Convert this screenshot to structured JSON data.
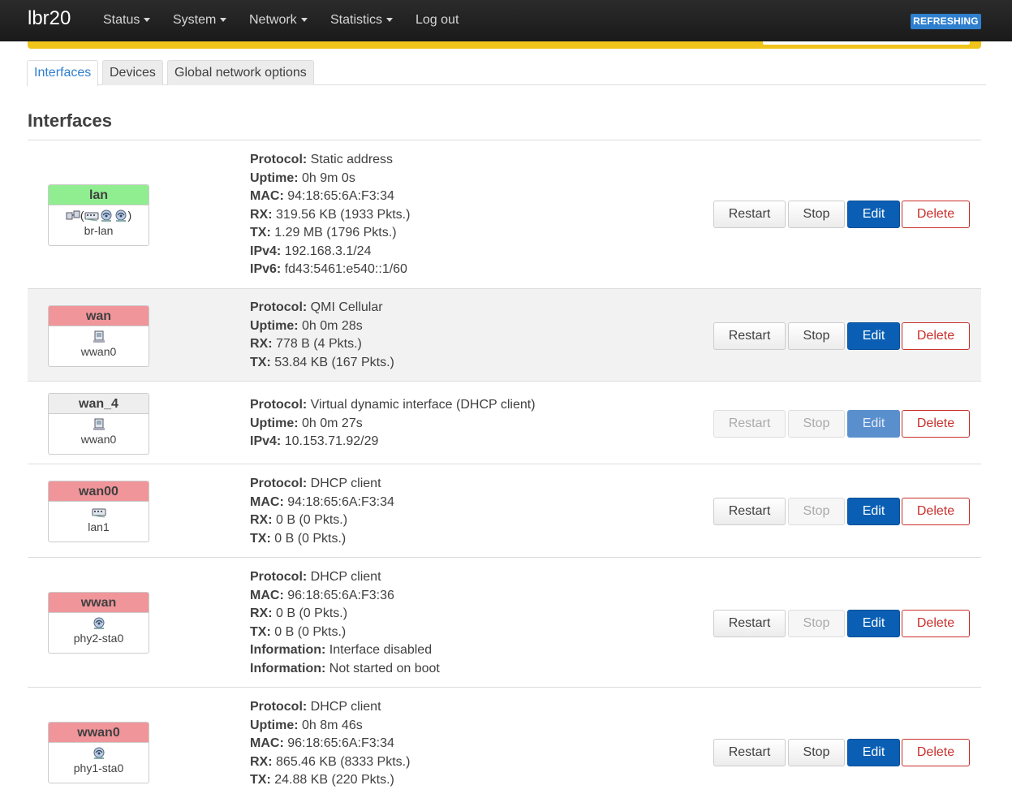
{
  "header": {
    "brand": "lbr20",
    "nav": [
      {
        "label": "Status",
        "dropdown": true
      },
      {
        "label": "System",
        "dropdown": true
      },
      {
        "label": "Network",
        "dropdown": true
      },
      {
        "label": "Statistics",
        "dropdown": true
      },
      {
        "label": "Log out",
        "dropdown": false
      }
    ],
    "status_badge": "REFRESHING"
  },
  "tabs": [
    {
      "label": "Interfaces",
      "active": true
    },
    {
      "label": "Devices",
      "active": false
    },
    {
      "label": "Global network options",
      "active": false
    }
  ],
  "page_title": "Interfaces",
  "buttons": {
    "restart": "Restart",
    "stop": "Stop",
    "edit": "Edit",
    "delete": "Delete"
  },
  "interfaces": [
    {
      "name": "lan",
      "status_color": "green",
      "device": "br-lan",
      "icons": [
        "bridge-icon",
        "(",
        "switch-icon",
        "wifi-icon",
        "wifi-icon",
        ")"
      ],
      "details": [
        {
          "label": "Protocol:",
          "value": "Static address"
        },
        {
          "label": "Uptime:",
          "value": "0h 9m 0s"
        },
        {
          "label": "MAC:",
          "value": "94:18:65:6A:F3:34"
        },
        {
          "label": "RX:",
          "value": "319.56 KB (1933 Pkts.)"
        },
        {
          "label": "TX:",
          "value": "1.29 MB (1796 Pkts.)"
        },
        {
          "label": "IPv4:",
          "value": "192.168.3.1/24"
        },
        {
          "label": "IPv6:",
          "value": "fd43:5461:e540::1/60"
        }
      ],
      "restart_enabled": true,
      "stop_enabled": true,
      "edit_enabled": true
    },
    {
      "name": "wan",
      "status_color": "red",
      "device": "wwan0",
      "icons": [
        "cellular-icon"
      ],
      "details": [
        {
          "label": "Protocol:",
          "value": "QMI Cellular"
        },
        {
          "label": "Uptime:",
          "value": "0h 0m 28s"
        },
        {
          "label": "RX:",
          "value": "778 B (4 Pkts.)"
        },
        {
          "label": "TX:",
          "value": "53.84 KB (167 Pkts.)"
        }
      ],
      "restart_enabled": true,
      "stop_enabled": true,
      "edit_enabled": true
    },
    {
      "name": "wan_4",
      "status_color": "gray",
      "device": "wwan0",
      "icons": [
        "cellular-icon"
      ],
      "details": [
        {
          "label": "Protocol:",
          "value": "Virtual dynamic interface (DHCP client)"
        },
        {
          "label": "Uptime:",
          "value": "0h 0m 27s"
        },
        {
          "label": "IPv4:",
          "value": "10.153.71.92/29"
        }
      ],
      "restart_enabled": false,
      "stop_enabled": false,
      "edit_enabled": false
    },
    {
      "name": "wan00",
      "status_color": "red",
      "device": "lan1",
      "icons": [
        "switch-icon"
      ],
      "details": [
        {
          "label": "Protocol:",
          "value": "DHCP client"
        },
        {
          "label": "MAC:",
          "value": "94:18:65:6A:F3:34"
        },
        {
          "label": "RX:",
          "value": "0 B (0 Pkts.)"
        },
        {
          "label": "TX:",
          "value": "0 B (0 Pkts.)"
        }
      ],
      "restart_enabled": true,
      "stop_enabled": false,
      "edit_enabled": true
    },
    {
      "name": "wwan",
      "status_color": "red",
      "device": "phy2-sta0",
      "icons": [
        "wifi-icon"
      ],
      "details": [
        {
          "label": "Protocol:",
          "value": "DHCP client"
        },
        {
          "label": "MAC:",
          "value": "96:18:65:6A:F3:36"
        },
        {
          "label": "RX:",
          "value": "0 B (0 Pkts.)"
        },
        {
          "label": "TX:",
          "value": "0 B (0 Pkts.)"
        },
        {
          "label": "Information:",
          "value": "Interface disabled"
        },
        {
          "label": "Information:",
          "value": "Not started on boot"
        }
      ],
      "restart_enabled": true,
      "stop_enabled": false,
      "edit_enabled": true
    },
    {
      "name": "wwan0",
      "status_color": "red",
      "device": "phy1-sta0",
      "icons": [
        "wifi-icon"
      ],
      "details": [
        {
          "label": "Protocol:",
          "value": "DHCP client"
        },
        {
          "label": "Uptime:",
          "value": "0h 8m 46s"
        },
        {
          "label": "MAC:",
          "value": "96:18:65:6A:F3:34"
        },
        {
          "label": "RX:",
          "value": "865.46 KB (8333 Pkts.)"
        },
        {
          "label": "TX:",
          "value": "24.88 KB (220 Pkts.)"
        }
      ],
      "restart_enabled": true,
      "stop_enabled": true,
      "edit_enabled": true
    }
  ]
}
